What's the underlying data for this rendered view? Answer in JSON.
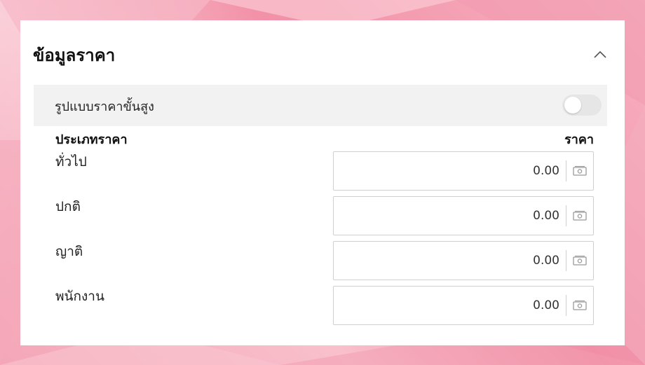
{
  "panel": {
    "title": "ข้อมูลราคา",
    "advanced": {
      "label": "รูปแบบราคาขั้นสูง",
      "enabled": false
    },
    "columns": {
      "type": "ประเภทราคา",
      "price": "ราคา"
    },
    "rows": [
      {
        "label": "ทั่วไป",
        "value": "0.00"
      },
      {
        "label": "ปกติ",
        "value": "0.00"
      },
      {
        "label": "ญาติ",
        "value": "0.00"
      },
      {
        "label": "พนักงาน",
        "value": "0.00"
      }
    ]
  },
  "icons": {
    "collapse": "chevron-up-icon",
    "currency": "cash-icon"
  },
  "colors": {
    "background": "#f4a6b7",
    "card": "#ffffff",
    "toggle_off": "#e6e6e6"
  }
}
